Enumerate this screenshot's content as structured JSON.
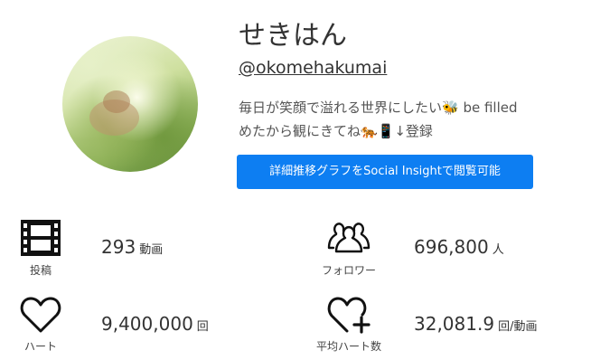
{
  "profile": {
    "name": "せきはん",
    "handle": "@okomehakumai",
    "bio_line1": "毎日が笑顔で溢れる世界にしたい🐝 be filled",
    "bio_line2": "めたから観にきてね🐅📱↓登録",
    "cta_label": "詳細推移グラフをSocial Insightで閲覧可能",
    "accent_color": "#0d7ef2"
  },
  "stats": {
    "posts": {
      "label": "投稿",
      "value": "293",
      "unit": "動画",
      "icon": "film-icon"
    },
    "followers": {
      "label": "フォロワー",
      "value": "696,800",
      "unit": "人",
      "icon": "users-icon"
    },
    "hearts": {
      "label": "ハート",
      "value": "9,400,000",
      "unit": "回",
      "icon": "heart-icon"
    },
    "avg_hearts": {
      "label": "平均ハート数",
      "value": "32,081.9",
      "unit": "回/動画",
      "icon": "heart-plus-icon"
    }
  }
}
